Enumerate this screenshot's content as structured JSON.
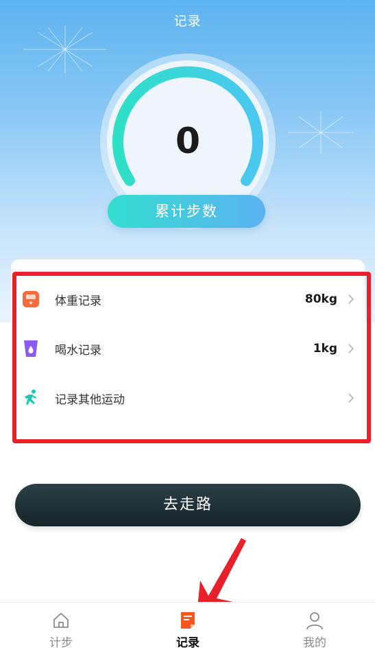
{
  "header": {
    "title": "记录"
  },
  "gauge": {
    "value": "0",
    "label": "累计步数",
    "progress": 0
  },
  "records": [
    {
      "label": "体重记录",
      "value": "80kg",
      "icon": "scale-icon"
    },
    {
      "label": "喝水记录",
      "value": "1kg",
      "icon": "water-cup-icon"
    },
    {
      "label": "记录其他运动",
      "value": "",
      "icon": "running-person-icon"
    }
  ],
  "action": {
    "go_label": "去走路"
  },
  "tabbar": {
    "items": [
      {
        "label": "计步",
        "icon": "home-icon",
        "active": false
      },
      {
        "label": "记录",
        "icon": "record-icon",
        "active": true
      },
      {
        "label": "我的",
        "icon": "person-icon",
        "active": false
      }
    ]
  },
  "colors": {
    "accent": "#33dfd0",
    "highlight_border": "#e8202a",
    "record_active": "#f4581f"
  }
}
